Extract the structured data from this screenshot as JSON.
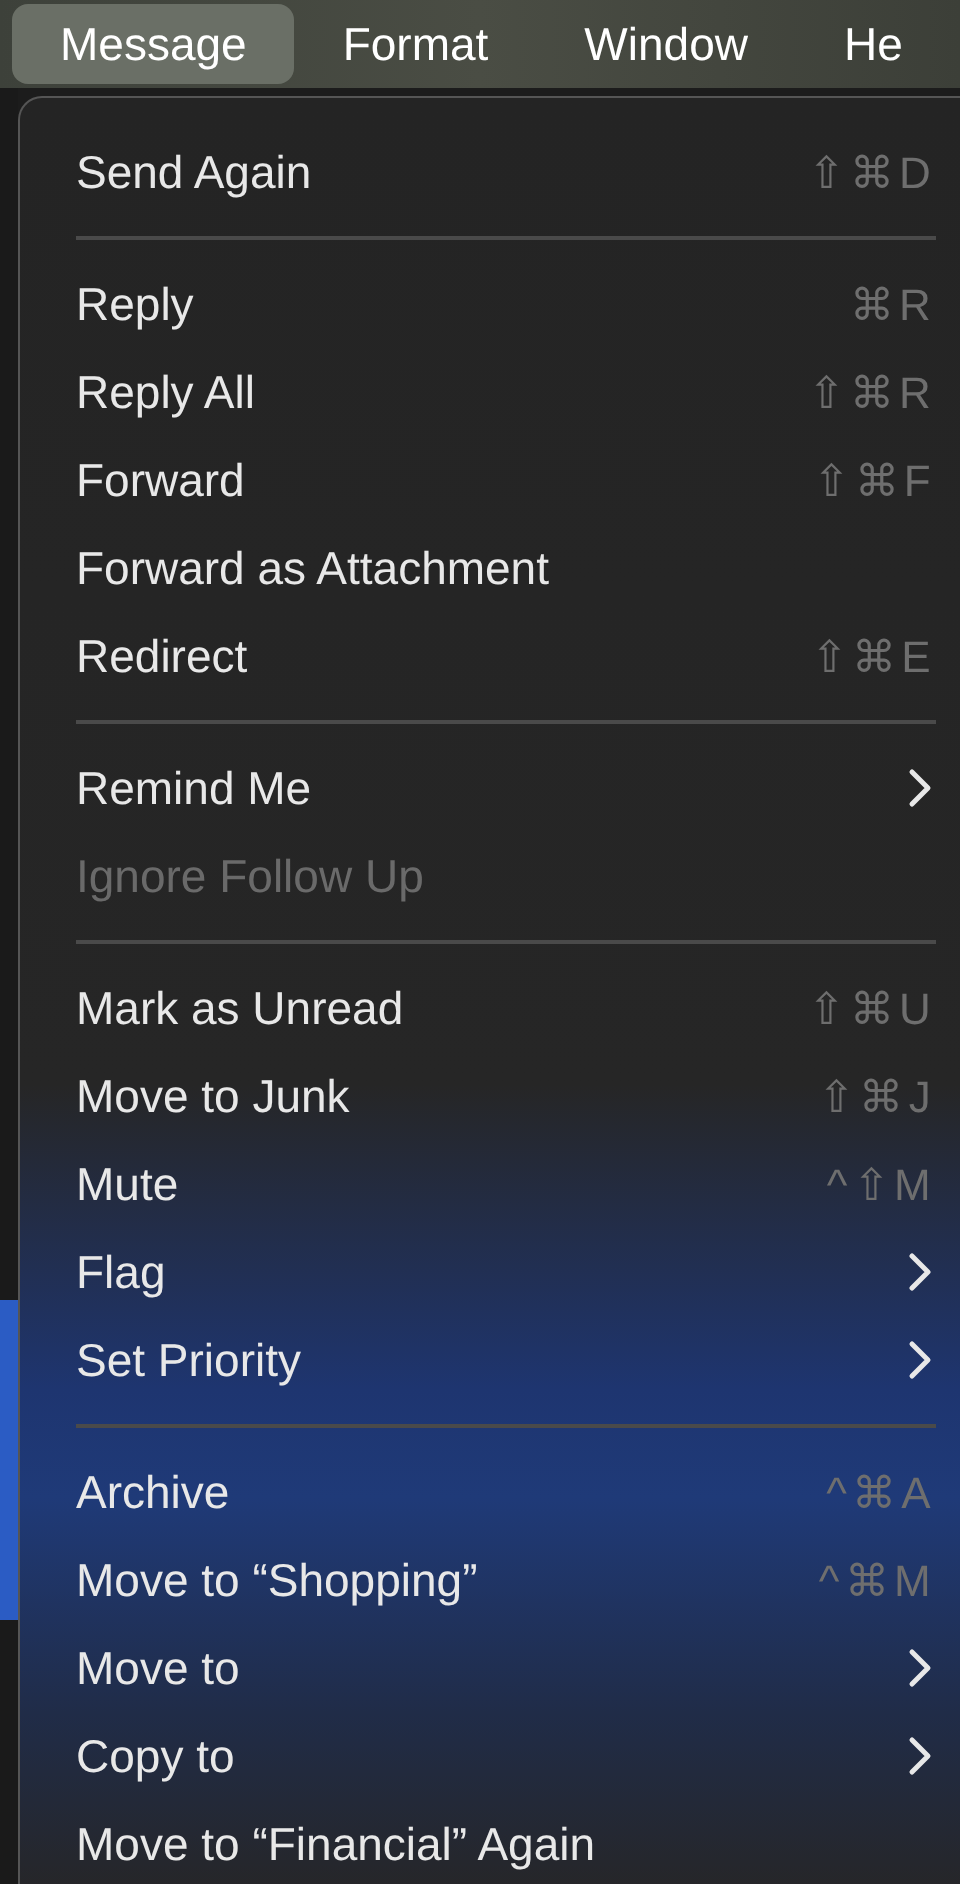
{
  "menu_bar": [
    {
      "label": "Message",
      "selected": true
    },
    {
      "label": "Format",
      "selected": false
    },
    {
      "label": "Window",
      "selected": false
    },
    {
      "label": "He",
      "selected": false
    }
  ],
  "menu": [
    {
      "kind": "item",
      "label": "Send Again",
      "shortcut": "⇧⌘D",
      "submenu": false,
      "disabled": false
    },
    {
      "kind": "separator"
    },
    {
      "kind": "item",
      "label": "Reply",
      "shortcut": "⌘R",
      "submenu": false,
      "disabled": false
    },
    {
      "kind": "item",
      "label": "Reply All",
      "shortcut": "⇧⌘R",
      "submenu": false,
      "disabled": false
    },
    {
      "kind": "item",
      "label": "Forward",
      "shortcut": "⇧⌘F",
      "submenu": false,
      "disabled": false
    },
    {
      "kind": "item",
      "label": "Forward as Attachment",
      "submenu": false,
      "disabled": false
    },
    {
      "kind": "item",
      "label": "Redirect",
      "shortcut": "⇧⌘E",
      "submenu": false,
      "disabled": false
    },
    {
      "kind": "separator"
    },
    {
      "kind": "item",
      "label": "Remind Me",
      "submenu": true,
      "disabled": false
    },
    {
      "kind": "item",
      "label": "Ignore Follow Up",
      "submenu": false,
      "disabled": true
    },
    {
      "kind": "separator"
    },
    {
      "kind": "item",
      "label": "Mark as Unread",
      "shortcut": "⇧⌘U",
      "submenu": false,
      "disabled": false
    },
    {
      "kind": "item",
      "label": "Move to Junk",
      "shortcut": "⇧⌘J",
      "submenu": false,
      "disabled": false
    },
    {
      "kind": "item",
      "label": "Mute",
      "shortcut": "^⇧M",
      "submenu": false,
      "disabled": false
    },
    {
      "kind": "item",
      "label": "Flag",
      "submenu": true,
      "disabled": false
    },
    {
      "kind": "item",
      "label": "Set Priority",
      "submenu": true,
      "disabled": false
    },
    {
      "kind": "separator"
    },
    {
      "kind": "item",
      "label": "Archive",
      "shortcut": "^⌘A",
      "submenu": false,
      "disabled": false
    },
    {
      "kind": "item",
      "label": "Move to “Shopping”",
      "shortcut": "^⌘M",
      "submenu": false,
      "disabled": false
    },
    {
      "kind": "item",
      "label": "Move to",
      "submenu": true,
      "disabled": false
    },
    {
      "kind": "item",
      "label": "Copy to",
      "submenu": true,
      "disabled": false
    },
    {
      "kind": "item",
      "label": "Move to “Financial” Again",
      "submenu": false,
      "disabled": false
    }
  ]
}
